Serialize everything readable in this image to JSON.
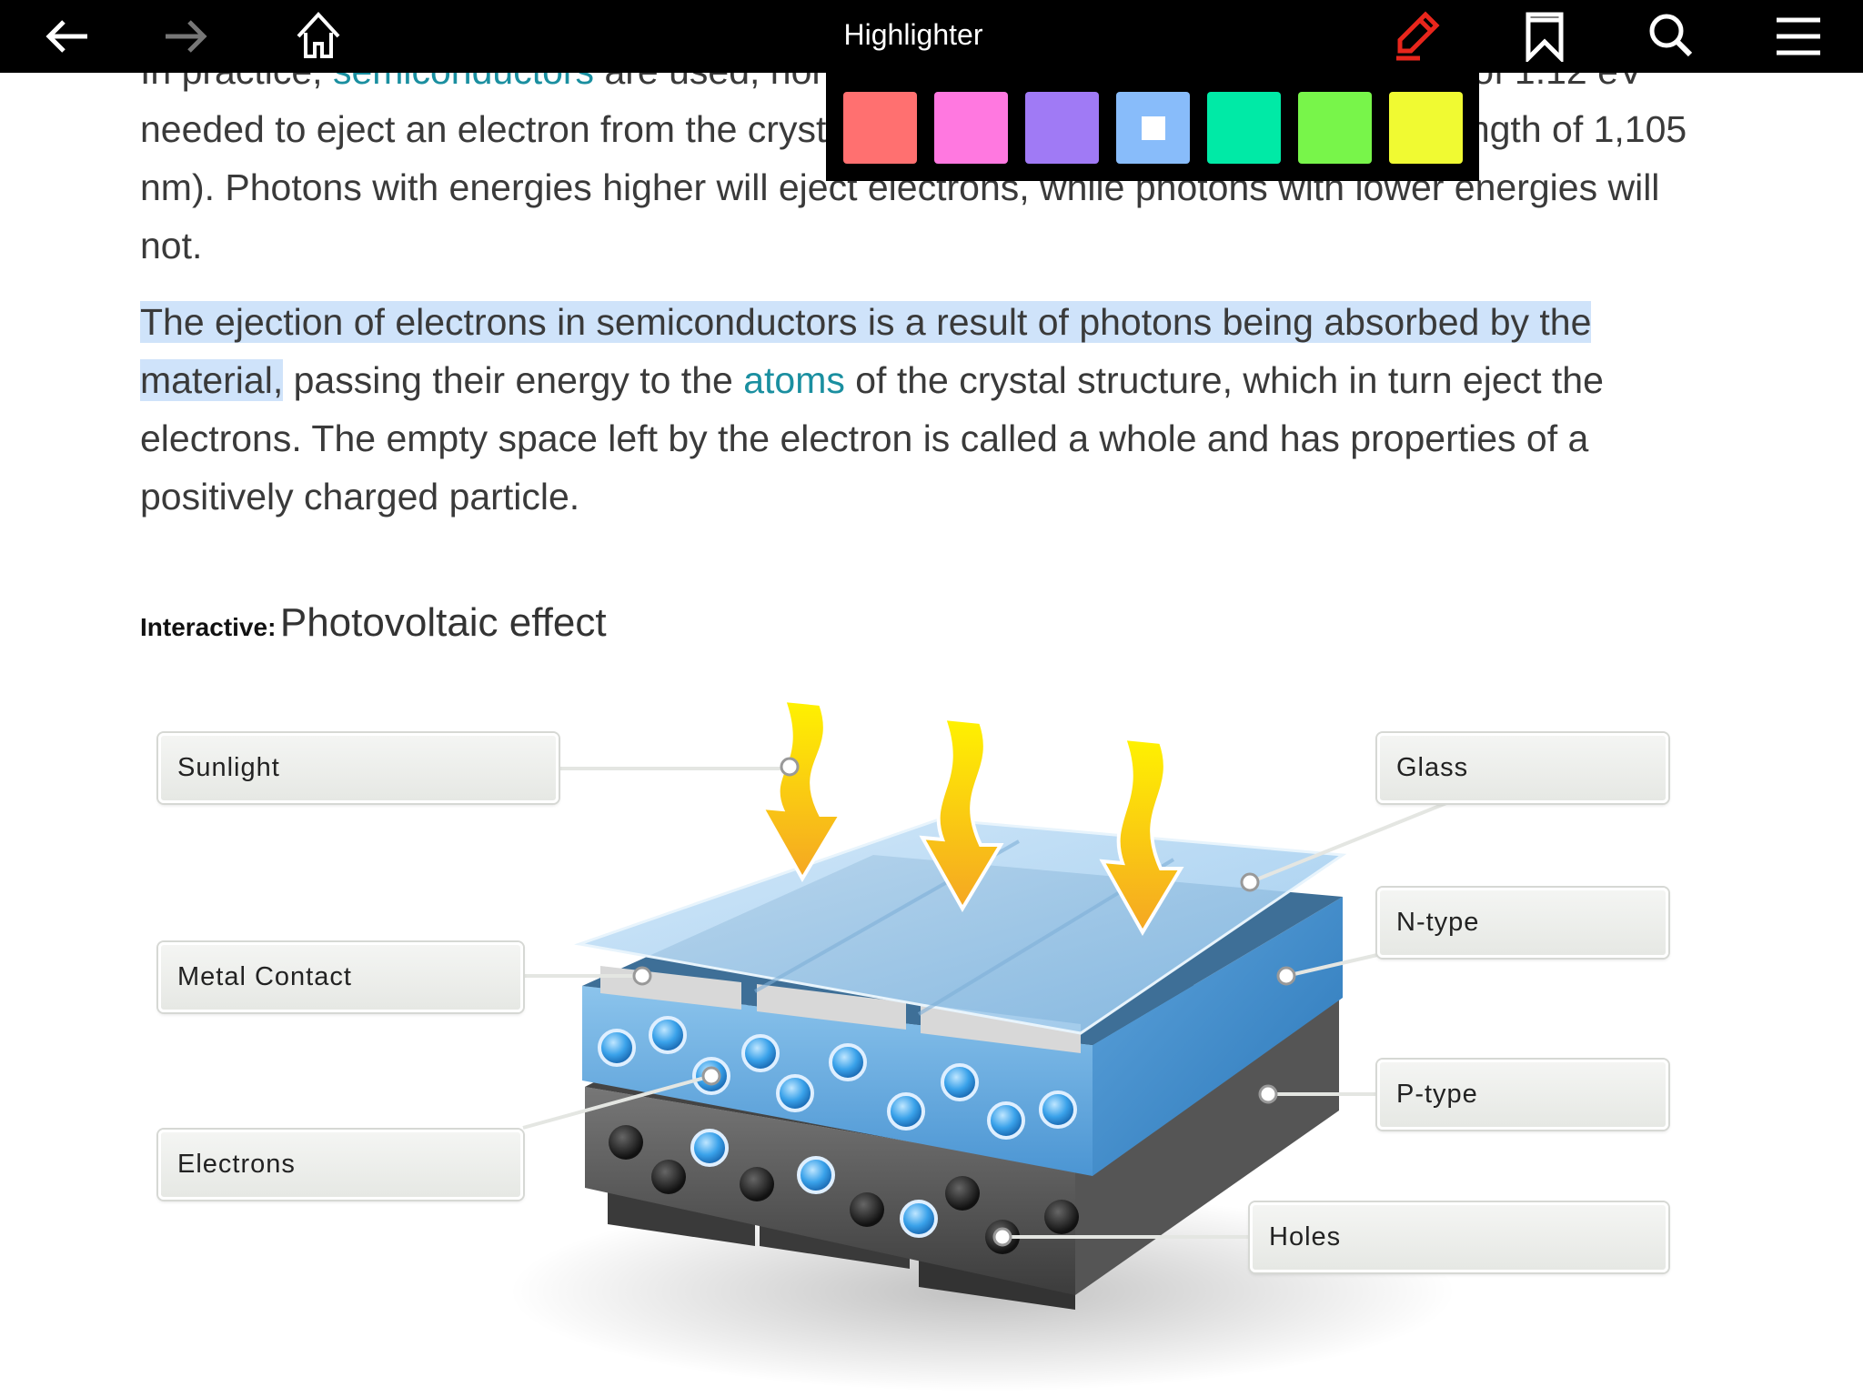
{
  "toolbar": {
    "title": "Highlighter",
    "icons": [
      "back-arrow-icon",
      "forward-arrow-icon",
      "home-icon",
      "highlighter-pencil-icon",
      "bookmark-icon",
      "search-icon",
      "menu-icon"
    ],
    "active_color": "#e8261c"
  },
  "palette": {
    "colors": [
      "#ff7070",
      "#ff78e0",
      "#a07af5",
      "#88bcfa",
      "#00eaa6",
      "#78f54a",
      "#f0fa32"
    ],
    "selected_index": 3
  },
  "article": {
    "p1": {
      "a": "In practice, ",
      "link": "semiconductors",
      "b": " are used, normally silicon, which requires an energy of 1.12 eV needed to eject an electron from the crystal structure (corresponding to a wavelength of 1,105 nm). Photons with energies higher will eject electrons, while photons with lower energies will not."
    },
    "p2": {
      "highlighted": "The ejection of electrons in semiconductors is a result of photons being absorbed by the material,",
      "a": " passing their energy to the ",
      "link": "atoms",
      "b": " of the crystal structure, which in turn eject the electrons. The empty space left by the electron is called a whole and has properties of a positively charged particle."
    }
  },
  "caption": {
    "prefix": "Interactive:",
    "title": "Photovoltaic effect"
  },
  "diagram": {
    "labels": {
      "sunlight": "Sunlight",
      "metal_contact": "Metal Contact",
      "electrons": "Electrons",
      "glass": "Glass",
      "n_type": "N-type",
      "p_type": "P-type",
      "holes": "Holes"
    }
  }
}
